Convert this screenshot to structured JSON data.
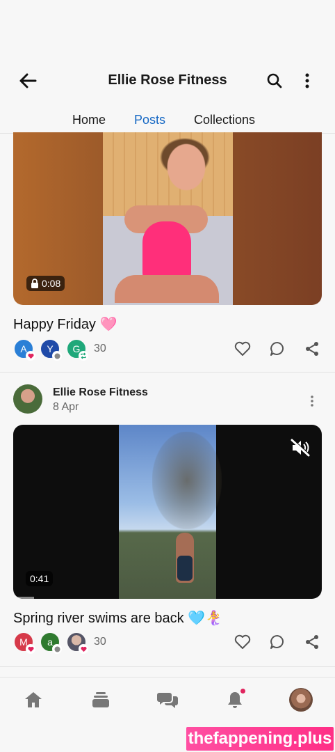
{
  "header": {
    "title": "Ellie Rose Fitness",
    "back_icon": "arrow-left-icon",
    "search_icon": "search-icon",
    "more_icon": "more-vertical-icon"
  },
  "tabs": [
    {
      "label": "Home",
      "active": false
    },
    {
      "label": "Posts",
      "active": true
    },
    {
      "label": "Collections",
      "active": false
    }
  ],
  "accent_color": "#1668c4",
  "posts": [
    {
      "duration": "0:08",
      "locked": true,
      "caption": "Happy Friday 🩷",
      "reactors": [
        {
          "initial": "A",
          "color": "#2a7fd6",
          "reaction": "heart"
        },
        {
          "initial": "Y",
          "color": "#1f4aa8",
          "reaction": "comment"
        },
        {
          "initial": "G",
          "color": "#1fa87a",
          "reaction": "repost"
        }
      ],
      "reaction_count": "30"
    },
    {
      "author": "Ellie Rose Fitness",
      "date": "8 Apr",
      "duration": "0:41",
      "muted": true,
      "caption": "Spring river swims are back 🩵🧜‍♀️",
      "reactors": [
        {
          "initial": "M",
          "color": "#d63a4a",
          "reaction": "heart"
        },
        {
          "initial": "a",
          "color": "#2f7a2f",
          "reaction": "comment"
        },
        {
          "initial": "",
          "color": "#9aa",
          "reaction": "heart"
        }
      ],
      "reaction_count": "30"
    }
  ],
  "bottom_nav": [
    {
      "name": "home-icon"
    },
    {
      "name": "collections-stack-icon"
    },
    {
      "name": "messages-icon"
    },
    {
      "name": "bell-icon",
      "has_notification": true
    },
    {
      "name": "profile-avatar"
    }
  ],
  "watermark": "thefappening.plus"
}
